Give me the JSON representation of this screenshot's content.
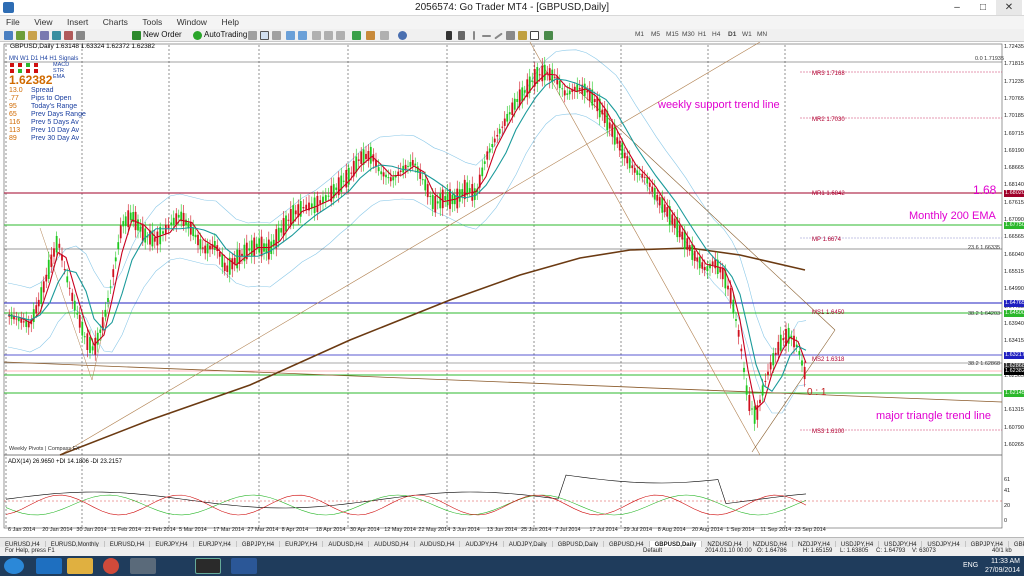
{
  "window": {
    "title": "2056574: Go Trader MT4 - [GBPUSD,Daily]",
    "minimize": "–",
    "maximize": "□",
    "close": "✕"
  },
  "menu": [
    "File",
    "View",
    "Insert",
    "Charts",
    "Tools",
    "Window",
    "Help"
  ],
  "toolbar": {
    "new_order": "New Order",
    "autotrading": "AutoTrading",
    "timeframes": [
      "M1",
      "M5",
      "M15",
      "M30",
      "H1",
      "H4",
      "D1",
      "W1",
      "MN"
    ]
  },
  "chart": {
    "symbol_line": "GBPUSD,Daily  1.63148 1.63324 1.62372 1.62382",
    "signal_header": "MN  W1  D1  H4  H1  Signals",
    "signal_rows": [
      "MACD",
      "STR",
      "EMA"
    ],
    "big_price": "1.62382",
    "indicator_rows": [
      {
        "value": "13.0",
        "label": "Spread"
      },
      {
        "value": ".77",
        "label": "Pips to Open"
      },
      {
        "value": "95",
        "label": "Today's Range"
      },
      {
        "value": "65",
        "label": "Prev Days Range"
      },
      {
        "value": "116",
        "label": "Prev 5 Days Av"
      },
      {
        "value": "113",
        "label": "Prev 10 Day Av"
      },
      {
        "value": "89",
        "label": "Prev 30 Day Av"
      }
    ],
    "annotations": {
      "weekly_support": "weekly support trend line",
      "level_168": "1.68",
      "monthly_ema": "Monthly 200 EMA",
      "major_triangle": "major triangle trend line",
      "ratio": "0 : 1",
      "pivots_footer": "Weekly Pivots | Compass FX"
    },
    "levels": [
      {
        "label": "MR3",
        "value": "1.7168"
      },
      {
        "label": "MR2",
        "value": "1.7030"
      },
      {
        "label": "MR1",
        "value": "1.6842"
      },
      {
        "label": "MP",
        "value": "1.6674"
      },
      {
        "label": "MS1",
        "value": "1.6450"
      },
      {
        "label": "MS2",
        "value": "1.6318"
      },
      {
        "label": "MS3",
        "value": "1.6100"
      }
    ],
    "fib_labels": [
      "0.0  1.71935",
      "23.6  1.66335",
      "38.2  1.64203",
      "38.2  1.62868"
    ],
    "y_axis": [
      "1.72435",
      "1.71815",
      "1.71235",
      "1.70765",
      "1.70185",
      "1.69715",
      "1.69190",
      "1.68665",
      "1.68140",
      "1.67615",
      "1.67090",
      "1.66565",
      "1.66040",
      "1.65515",
      "1.64990",
      "1.64465",
      "1.63940",
      "1.63415",
      "1.62890",
      "1.62365",
      "1.61840",
      "1.61315",
      "1.60790",
      "1.60265"
    ],
    "price_tags": [
      {
        "text": "1.68020",
        "color": "#a0002a"
      },
      {
        "text": "1.67750",
        "color": "#2cb82c"
      },
      {
        "text": "1.64765",
        "color": "#2020c0"
      },
      {
        "text": "1.64500",
        "color": "#2cb82c"
      },
      {
        "text": "1.63217",
        "color": "#2020c0"
      },
      {
        "text": "1.62868",
        "color": "#333333"
      },
      {
        "text": "1.62382",
        "color": "#000000"
      },
      {
        "text": "1.62145",
        "color": "#2cb82c"
      }
    ],
    "x_axis": [
      "6 Jan 2014",
      "20 Jan 2014",
      "30 Jan 2014",
      "11 Feb 2014",
      "21 Feb 2014",
      "5 Mar 2014",
      "17 Mar 2014",
      "27 Mar 2014",
      "8 Apr 2014",
      "18 Apr 2014",
      "30 Apr 2014",
      "12 May 2014",
      "22 May 2014",
      "3 Jun 2014",
      "13 Jun 2014",
      "25 Jun 2014",
      "7 Jul 2014",
      "17 Jul 2014",
      "29 Jul 2014",
      "8 Aug 2014",
      "20 Aug 2014",
      "1 Sep 2014",
      "11 Sep 2014",
      "23 Sep 2014"
    ],
    "adx_label": "ADX(14) 26.9650 +DI 14.1806 -DI 23.2157",
    "adx_axis": [
      "61",
      "41",
      "20",
      "0"
    ]
  },
  "tabs": [
    "EURUSD,H4",
    "EURUSD,Monthly",
    "EURUSD,H4",
    "EURJPY,H4",
    "EURJPY,H4",
    "GBPJPY,H4",
    "EURJPY,H4",
    "AUDUSD,H4",
    "AUDUSD,H4",
    "AUDUSD,H4",
    "AUDJPY,H4",
    "AUDJPY,Daily",
    "GBPUSD,Daily",
    "GBPUSD,H4",
    "GBPUSD,Daily",
    "NZDUSD,H4",
    "NZDUSD,H4",
    "NZDJPY,H4",
    "USDJPY,H4",
    "USDJPY,H4",
    "USDJPY,H4",
    "GBPJPY,H4",
    "GBPJPY,H4",
    "EURJPY,H4",
    "AUDN"
  ],
  "active_tab_index": 14,
  "status": {
    "help": "For Help, press F1",
    "profile": "Default",
    "time": "2014.01.10 00:00",
    "open": "O: 1.64786",
    "high": "H: 1.65159",
    "low": "L: 1.63805",
    "close": "C: 1.64793",
    "volume": "V: 63073",
    "kb": "40/1 kb"
  },
  "taskbar": {
    "lang": "ENG",
    "clock": "11:33 AM",
    "date": "27/09/2014"
  },
  "colors": {
    "ema_red": "#c8001e",
    "ema_teal": "#1a9a9a",
    "ema200": "#6b3a12",
    "bull": "#1ec81e",
    "bear": "#d0101e",
    "annotation": "#e000d0"
  }
}
